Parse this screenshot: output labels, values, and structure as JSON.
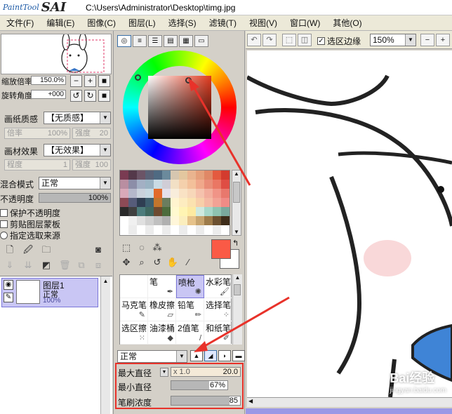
{
  "titlebar": {
    "logo_small": "PaintTool",
    "logo_big": "SAI",
    "path": "C:\\Users\\Administrator\\Desktop\\timg.jpg"
  },
  "menu": [
    "文件(F)",
    "编辑(E)",
    "图像(C)",
    "图层(L)",
    "选择(S)",
    "滤镜(T)",
    "视图(V)",
    "窗口(W)",
    "其他(O)"
  ],
  "navigator": {
    "zoom_label": "缩放倍率",
    "zoom_value": "150.0%",
    "rotate_label": "旋转角度",
    "rotate_value": "+000"
  },
  "paper": {
    "texture_label": "画纸质感",
    "texture_value": "【无质感】",
    "texture_scale_label": "倍率",
    "texture_scale_value": "100%",
    "texture_strength_label": "强度",
    "texture_strength_value": "20",
    "effect_label": "画材效果",
    "effect_value": "【无效果】",
    "effect_degree_label": "程度",
    "effect_degree_value": "1",
    "effect_strength_label": "强度",
    "effect_strength_value": "100"
  },
  "layer_props": {
    "blend_label": "混合模式",
    "blend_value": "正常",
    "opacity_label": "不透明度",
    "opacity_value": "100%",
    "preserve_opacity": "保护不透明度",
    "clipping": "剪贴图层蒙板",
    "selection_source": "指定选取来源"
  },
  "layer": {
    "name": "图层1",
    "mode": "正常",
    "opacity": "100%"
  },
  "tools": [
    {
      "label": "",
      "icon": "blank"
    },
    {
      "label": "笔",
      "icon": "pen-icon"
    },
    {
      "label": "喷枪",
      "icon": "airbrush-icon"
    },
    {
      "label": "水彩笔",
      "icon": "watercolor-icon"
    },
    {
      "label": "马克笔",
      "icon": "marker-icon"
    },
    {
      "label": "橡皮擦",
      "icon": "eraser-icon"
    },
    {
      "label": "铅笔",
      "icon": "pencil-icon"
    },
    {
      "label": "选择笔",
      "icon": "select-pen-icon"
    },
    {
      "label": "选区擦",
      "icon": "select-eraser-icon"
    },
    {
      "label": "油漆桶",
      "icon": "bucket-icon"
    },
    {
      "label": "2值笔",
      "icon": "binary-pen-icon"
    },
    {
      "label": "和纸笔",
      "icon": "washi-pen-icon"
    }
  ],
  "brush": {
    "mode_value": "正常",
    "max_size_label": "最大直径",
    "max_size_mult": "x 1.0",
    "max_size_value": "20.0",
    "min_size_label": "最小直径",
    "min_size_value": "67%",
    "min_size_fraction": 0.67,
    "density_label": "笔刷浓度",
    "density_value": "85",
    "density_fraction": 0.85
  },
  "canvas_toolbar": {
    "selection_edge_label": "选区边缘",
    "zoom_value": "150%"
  },
  "colors": {
    "foreground": "#fa5a46",
    "background": "#ffffff",
    "accent": "#e8322a",
    "layer_selected": "#c9c6f4"
  },
  "palette": [
    "#7a3b52",
    "#54394a",
    "#6b5466",
    "#5a6277",
    "#4f6a82",
    "#6b8a9c",
    "#d6c6b0",
    "#e3c79f",
    "#e9b48f",
    "#e5a07b",
    "#e08866",
    "#e45a3f",
    "#d33b2e",
    "#b98ea1",
    "#8c8ea8",
    "#a3b0c4",
    "#9ab3c3",
    "#c9dbe4",
    "#d0cdd6",
    "#f2e0c5",
    "#f4d0ac",
    "#f3c09a",
    "#f0a88b",
    "#e98d77",
    "#ea7764",
    "#df4d44",
    "#d9a9b9",
    "#b5b8cb",
    "#c9d2dc",
    "#c5d8e2",
    "#e26a2a",
    "#e5e1ea",
    "#f8eddb",
    "#f9e2c4",
    "#f7d7b9",
    "#f5c2ad",
    "#f2ad9c",
    "#f09487",
    "#e8786d",
    "#8c4a56",
    "#565c7a",
    "#2f3e52",
    "#3d5e6e",
    "#c1752d",
    "#6b7d5e",
    "#fff4cf",
    "#fdecc0",
    "#fbe2b0",
    "#f8cfa9",
    "#f5b9a3",
    "#f2a295",
    "#f08b86",
    "#2a2a2a",
    "#404040",
    "#4d7c7c",
    "#3f6860",
    "#6d4a30",
    "#4c6b3c",
    "#fff9cf",
    "#fff4b3",
    "#fdeaa1",
    "#cfe9df",
    "#a7d7c9",
    "#8ec3b1",
    "#7aa99d",
    "#ffffff",
    "#f0f0f0",
    "#e0e0e0",
    "#d0d0d0",
    "#c0c0c0",
    "#b0b0b0",
    "#fff6d9",
    "#fbeebd",
    "#e6c28a",
    "#c7a46f",
    "#9d7b4a",
    "#6b5030",
    "#3e2d1a",
    "#ffffff",
    "#ececec",
    "#ffffff",
    "#ececec",
    "#ffffff",
    "#ececec",
    "#ffffff",
    "#ececec",
    "#ffffff",
    "#ececec",
    "#ffffff",
    "#ececec",
    "#ffffff"
  ],
  "watermark": {
    "brand": "Bai经验",
    "url": "jingyan.baidu.com"
  }
}
